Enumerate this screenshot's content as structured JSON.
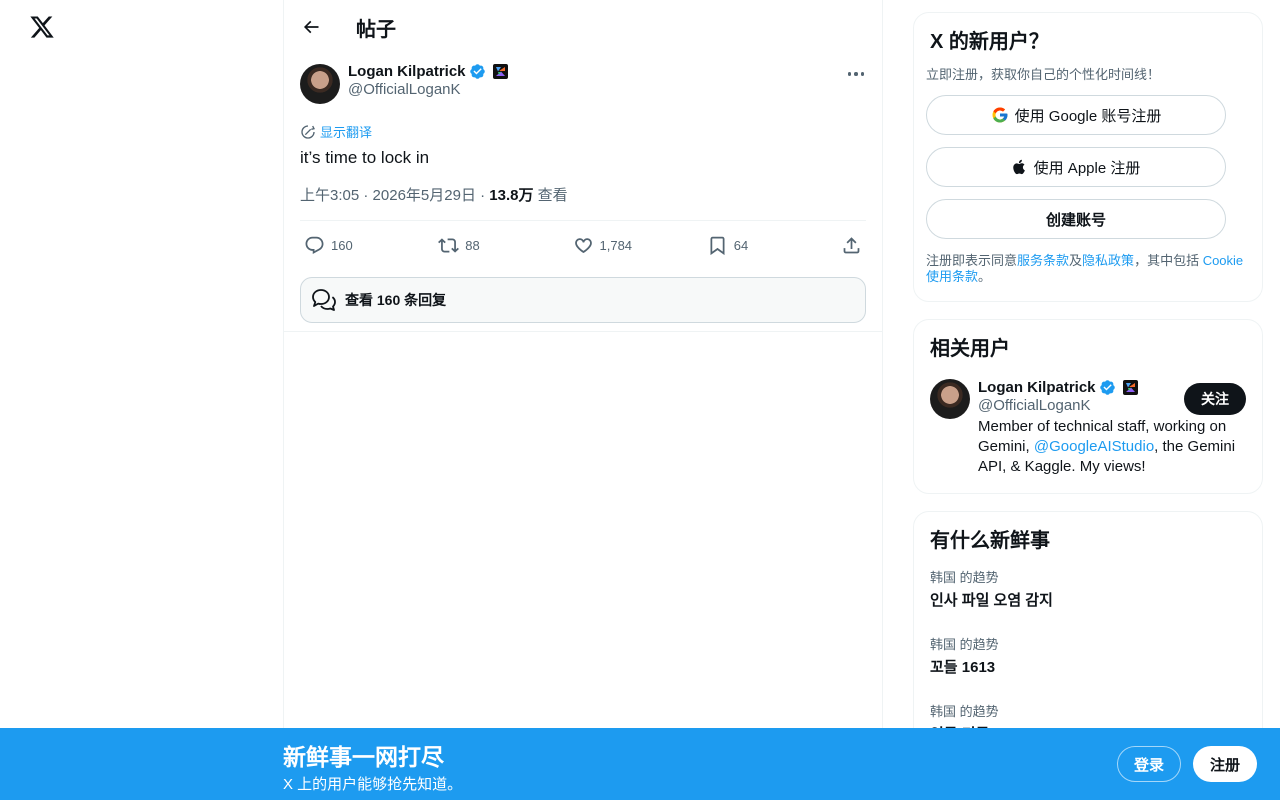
{
  "brand": {
    "logo": "x-logo-icon"
  },
  "header": {
    "title": "帖子"
  },
  "post": {
    "author_name": "Logan Kilpatrick",
    "handle": "@OfficialLoganK",
    "translate_label": "显示翻译",
    "text": "it’s time to lock in",
    "time": "上午3:05",
    "date": "2026年5月29日",
    "views_count": "13.8万",
    "views_label": "查看",
    "actions": {
      "replies": "160",
      "reposts": "88",
      "likes": "1,784",
      "bookmarks": "64"
    },
    "view_replies_label": "查看 160 条回复"
  },
  "signup_card": {
    "title": "X 的新用户？",
    "subtitle": "立即注册，获取你自己的个性化时间线！",
    "google_label": "使用 Google 账号注册",
    "apple_label": "使用 Apple 注册",
    "create_label": "创建账号",
    "legal_prefix": "注册即表示同意",
    "terms_link": "服务条款",
    "legal_and": "及",
    "privacy_link": "隐私政策",
    "legal_mid": "，其中包括 ",
    "cookie_link": "Cookie 使用条款",
    "legal_end": "。"
  },
  "related": {
    "title": "相关用户",
    "user_name": "Logan Kilpatrick",
    "user_handle": "@OfficialLoganK",
    "follow_label": "关注",
    "bio_before": "Member of technical staff, working on Gemini, ",
    "bio_link": "@GoogleAIStudio",
    "bio_after": ", the Gemini API, & Kaggle. My views!"
  },
  "trends": {
    "title": "有什么新鲜事",
    "items": [
      {
        "meta": "韩国 的趋势",
        "name": "인사 파일 오염 감지"
      },
      {
        "meta": "韩国 的趋势",
        "name": "꼬들 1613"
      },
      {
        "meta": "韩国 的趋势",
        "name": "인물 기록"
      }
    ]
  },
  "bottom_bar": {
    "title": "新鲜事一网打尽",
    "subtitle": "X 上的用户能够抢先知道。",
    "login_label": "登录",
    "signup_label": "注册"
  },
  "colors": {
    "accent": "#1d9bf0",
    "text": "#0f1419",
    "muted": "#536471"
  }
}
